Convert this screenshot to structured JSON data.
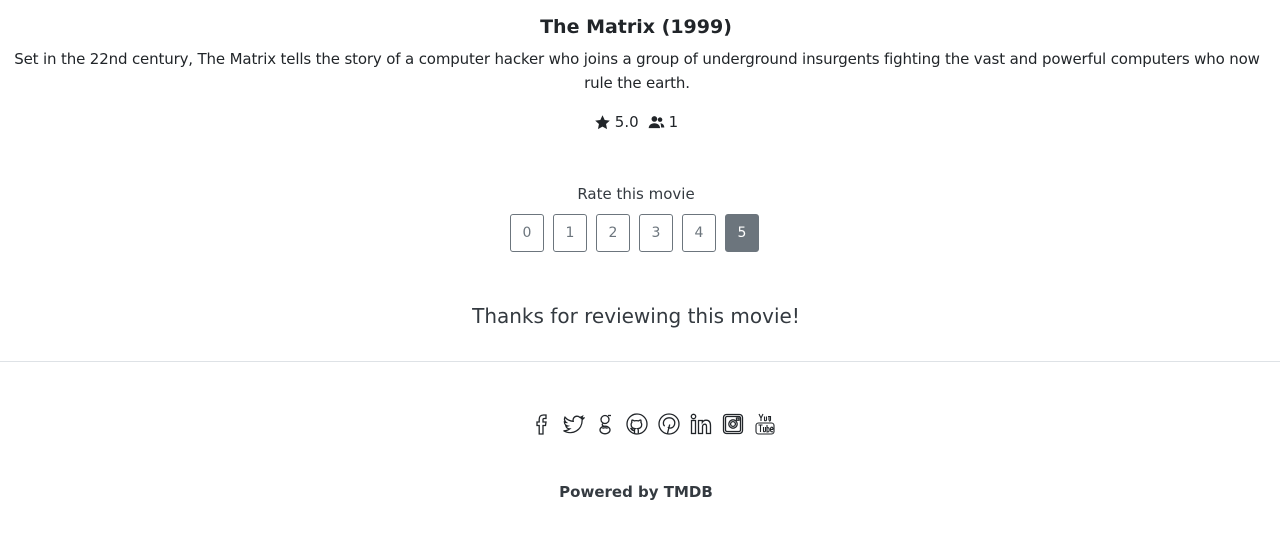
{
  "movie": {
    "title": "The Matrix (1999)",
    "overview": "Set in the 22nd century, The Matrix tells the story of a computer hacker who joins a group of underground insurgents fighting the vast and powerful computers who now rule the earth.",
    "rating": "5.0",
    "vote_count": "1",
    "rating_icon": "star-icon",
    "votes_icon": "users-icon"
  },
  "rate": {
    "label": "Rate this movie",
    "options": [
      "0",
      "1",
      "2",
      "3",
      "4",
      "5"
    ],
    "selected": "5"
  },
  "thanks_message": "Thanks for reviewing this movie!",
  "footer": {
    "social_icons": [
      "facebook-icon",
      "twitter-icon",
      "google-icon",
      "github-icon",
      "pinterest-icon",
      "linkedin-icon",
      "instagram-icon",
      "youtube-icon"
    ],
    "powered_by": "Powered by TMDB"
  },
  "colors": {
    "button_border": "#6c757d",
    "button_active_bg": "#6c757d",
    "divider": "#dee2e6"
  }
}
